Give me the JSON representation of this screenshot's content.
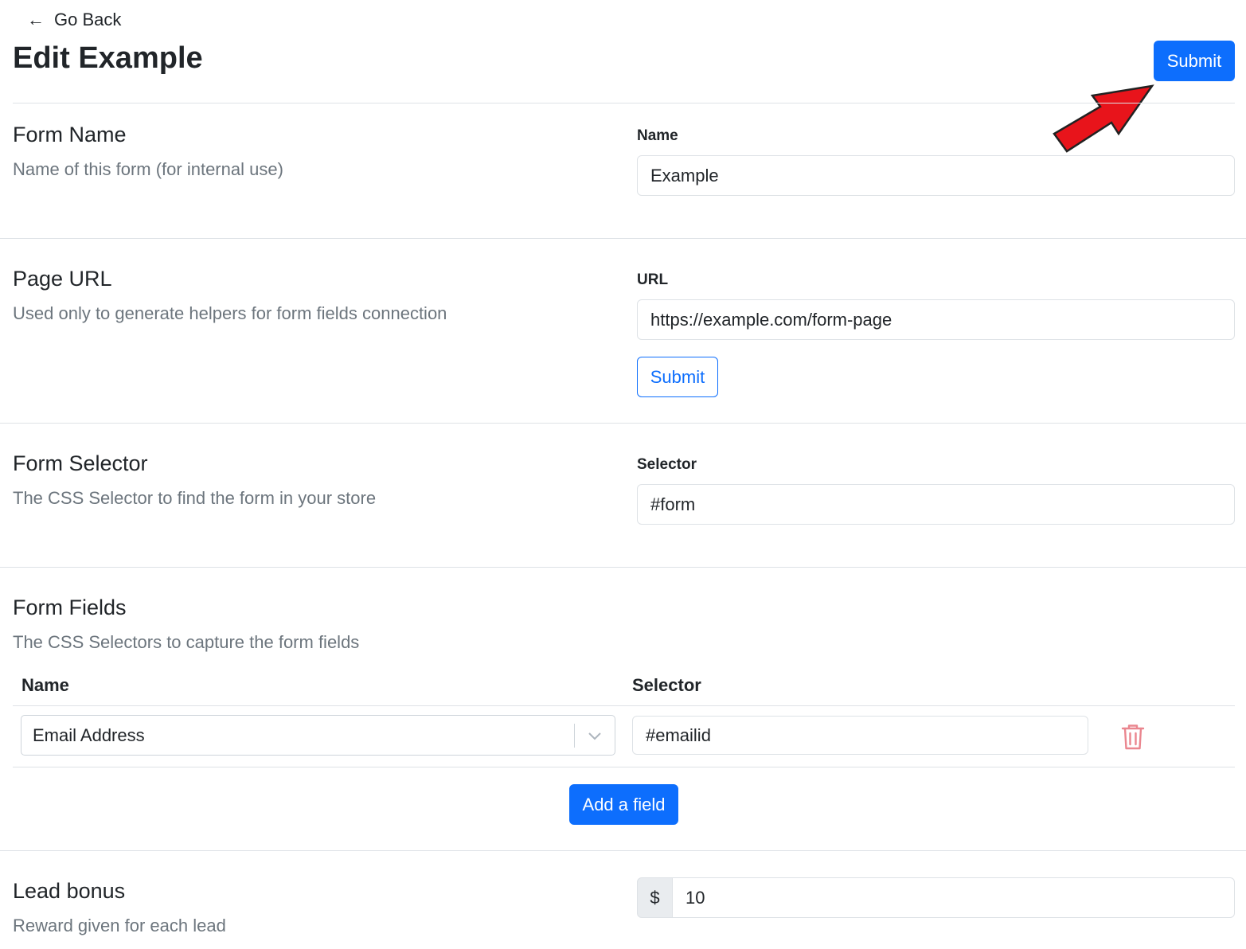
{
  "header": {
    "back_label": "Go Back",
    "back_icon": "←",
    "title": "Edit Example",
    "submit_label": "Submit"
  },
  "sections": {
    "form_name": {
      "title": "Form Name",
      "description": "Name of this form (for internal use)",
      "field_label": "Name",
      "value": "Example"
    },
    "page_url": {
      "title": "Page URL",
      "description": "Used only to generate helpers for form fields connection",
      "field_label": "URL",
      "value": "https://example.com/form-page",
      "submit_label": "Submit"
    },
    "form_selector": {
      "title": "Form Selector",
      "description": "The CSS Selector to find the form in your store",
      "field_label": "Selector",
      "value": "#form"
    },
    "form_fields": {
      "title": "Form Fields",
      "description": "The CSS Selectors to capture the form fields",
      "columns": [
        "Name",
        "Selector"
      ],
      "rows": [
        {
          "name": "Email Address",
          "selector": "#emailid"
        }
      ],
      "add_label": "Add a field"
    },
    "lead_bonus": {
      "title": "Lead bonus",
      "description": "Reward given for each lead",
      "prefix": "$",
      "value": "10"
    }
  },
  "colors": {
    "primary": "#0d6efd",
    "danger": "#ea868f",
    "annotation": "#e8141b"
  }
}
